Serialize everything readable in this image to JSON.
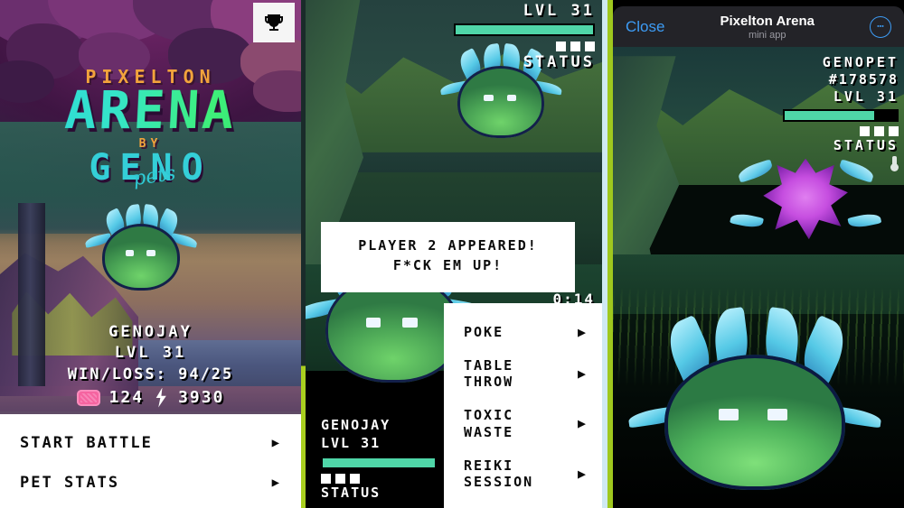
{
  "panel1": {
    "name": "home-screen",
    "trophy_icon": "trophy-icon",
    "logo": {
      "top": "PIXELTON",
      "main": "ARENA",
      "by": "BY",
      "brand": "GENO",
      "brand_script": "pets"
    },
    "stats": {
      "pet_name": "GENOJAY",
      "level": "LVL 31",
      "winloss_label": "WIN/LOSS:",
      "winloss_value": "94/25",
      "gem_icon": "gem-icon",
      "gem_value": "124",
      "bolt_icon": "energy-bolt-icon",
      "bolt_value": "3930"
    },
    "menu": [
      {
        "label": "START BATTLE",
        "arrow": "▶"
      },
      {
        "label": "PET STATS",
        "arrow": "▶"
      }
    ]
  },
  "panel2": {
    "name": "battle-screen",
    "opponent": {
      "level": "LVL 31",
      "hp_percent": 100,
      "status_label": "STATUS",
      "status_dots": 3
    },
    "dialog": {
      "line1": "PLAYER 2 APPEARED!",
      "line2": "F*CK EM UP!"
    },
    "timer": "0:14",
    "actions": [
      {
        "label": "POKE",
        "arrow": "▶"
      },
      {
        "label": "TABLE\nTHROW",
        "arrow": "▶"
      },
      {
        "label": "TOXIC\nWASTE",
        "arrow": "▶"
      },
      {
        "label": "REIKI\nSESSION",
        "arrow": "▶"
      }
    ],
    "player": {
      "pet_name": "GENOJAY",
      "level": "LVL 31",
      "hp_percent": 100,
      "status_label": "STATUS",
      "status_dots": 3
    }
  },
  "panel3": {
    "name": "mini-app-screen",
    "header": {
      "close_label": "Close",
      "title": "Pixelton Arena",
      "subtitle": "mini app",
      "more_icon": "more-dots-icon"
    },
    "stats": {
      "pet_name": "GENOPET",
      "pet_id": "#178578",
      "level": "LVL 31",
      "hp_percent": 80,
      "status_label": "STATUS",
      "status_dots": 3,
      "status_icon": "thermometer-icon"
    }
  },
  "colors": {
    "hp_green": "#4fd6a8",
    "accent_orange": "#f2a33c",
    "logo_cyan": "#2ad6e0",
    "logo_green": "#3ef07a",
    "telegram_blue": "#3d9cf5",
    "gem_pink": "#f564a0",
    "edge_lime": "#a9cf1f"
  }
}
